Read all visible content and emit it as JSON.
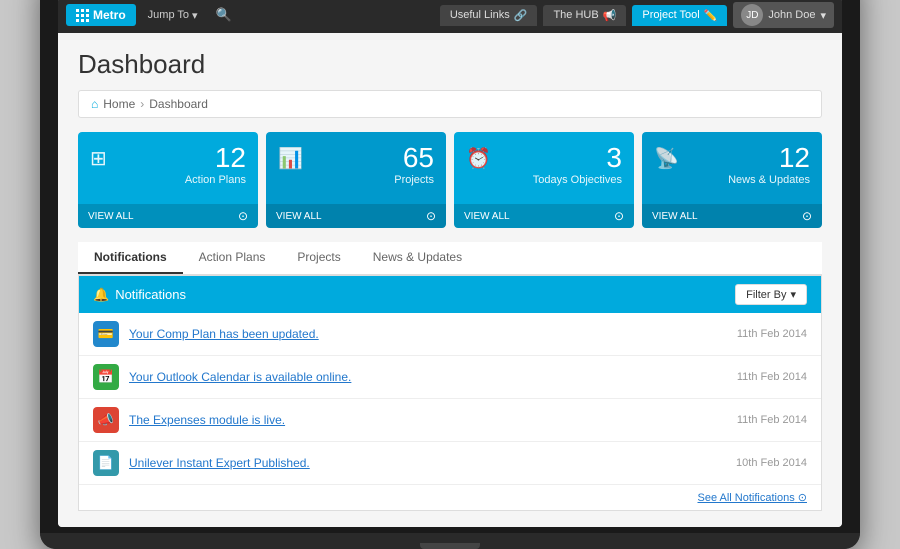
{
  "nav": {
    "metro_label": "Metro",
    "jump_label": "Jump To",
    "tabs": [
      {
        "label": "Useful Links",
        "icon": "🔗"
      },
      {
        "label": "The HUB",
        "icon": "📢"
      },
      {
        "label": "Project Tool",
        "icon": "✏️"
      }
    ],
    "user": "John Doe"
  },
  "header": {
    "title": "Dashboard",
    "breadcrumb": [
      "Home",
      "Dashboard"
    ]
  },
  "stat_cards": [
    {
      "number": "12",
      "label": "Action Plans",
      "view_all": "VIEW ALL",
      "icon": "⊞"
    },
    {
      "number": "65",
      "label": "Projects",
      "view_all": "VIEW ALL",
      "icon": "📊"
    },
    {
      "number": "3",
      "label": "Todays Objectives",
      "view_all": "VIEW ALL",
      "icon": "⏰"
    },
    {
      "number": "12",
      "label": "News & Updates",
      "view_all": "VIEW ALL",
      "icon": "📡"
    }
  ],
  "tabs": [
    "Notifications",
    "Action Plans",
    "Projects",
    "News & Updates"
  ],
  "notifications": {
    "header": "Notifications",
    "filter_label": "Filter By",
    "items": [
      {
        "text": "Your Comp Plan has been updated.",
        "date": "11th Feb 2014",
        "color": "blue",
        "icon": "💳"
      },
      {
        "text": "Your Outlook Calendar is available online.",
        "date": "11th Feb 2014",
        "color": "green",
        "icon": "📅"
      },
      {
        "text": "The Expenses module is live.",
        "date": "11th Feb 2014",
        "color": "red",
        "icon": "📣"
      },
      {
        "text": "Unilever Instant Expert Published.",
        "date": "10th Feb 2014",
        "color": "teal",
        "icon": "📄"
      }
    ],
    "see_all": "See All Notifications"
  }
}
